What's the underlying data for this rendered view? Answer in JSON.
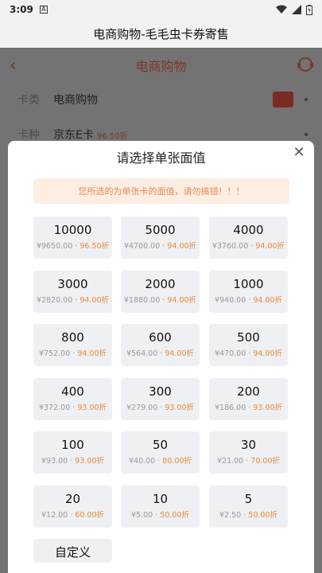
{
  "status": {
    "time": "3:09",
    "notif_icon": "A"
  },
  "app_title": "电商购物-毛毛虫卡券寄售",
  "background": {
    "nav_title": "电商购物",
    "rows": [
      {
        "label": "卡类",
        "value": "电商购物",
        "discount": ""
      },
      {
        "label": "卡种",
        "value": "京东E卡",
        "discount": "96.50折"
      }
    ]
  },
  "modal": {
    "title": "请选择单张面值",
    "close": "✕",
    "notice": "您所选的为单张卡的面值，请勿搞错！！！",
    "cards": [
      {
        "amount": "10000",
        "price": "¥9650.00",
        "rate": "96.50折"
      },
      {
        "amount": "5000",
        "price": "¥4700.00",
        "rate": "94.00折"
      },
      {
        "amount": "4000",
        "price": "¥3760.00",
        "rate": "94.00折"
      },
      {
        "amount": "3000",
        "price": "¥2820.00",
        "rate": "94.00折"
      },
      {
        "amount": "2000",
        "price": "¥1880.00",
        "rate": "94.00折"
      },
      {
        "amount": "1000",
        "price": "¥940.00",
        "rate": "94.00折"
      },
      {
        "amount": "800",
        "price": "¥752.00",
        "rate": "94.00折"
      },
      {
        "amount": "600",
        "price": "¥564.00",
        "rate": "94.00折"
      },
      {
        "amount": "500",
        "price": "¥470.00",
        "rate": "94.00折"
      },
      {
        "amount": "400",
        "price": "¥372.00",
        "rate": "93.00折"
      },
      {
        "amount": "300",
        "price": "¥279.00",
        "rate": "93.00折"
      },
      {
        "amount": "200",
        "price": "¥186.00",
        "rate": "93.00折"
      },
      {
        "amount": "100",
        "price": "¥93.00",
        "rate": "93.00折"
      },
      {
        "amount": "50",
        "price": "¥40.00",
        "rate": "80.00折"
      },
      {
        "amount": "30",
        "price": "¥21.00",
        "rate": "70.00折"
      },
      {
        "amount": "20",
        "price": "¥12.00",
        "rate": "60.00折"
      },
      {
        "amount": "10",
        "price": "¥5.00",
        "rate": "50.00折"
      },
      {
        "amount": "5",
        "price": "¥2.50",
        "rate": "50.00折"
      }
    ],
    "custom_label": "自定义"
  }
}
